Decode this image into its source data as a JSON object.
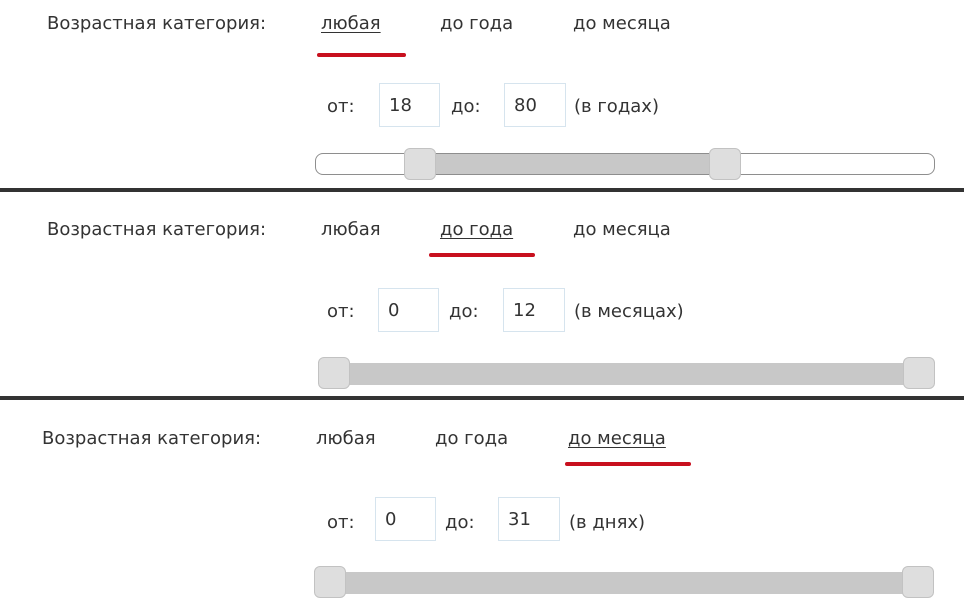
{
  "panels": [
    {
      "category_label": "Возрастная категория:",
      "tabs": [
        "любая",
        "до года",
        "до месяца"
      ],
      "active_tab": 0,
      "from_label": "от:",
      "from_value": "18",
      "to_label": "до:",
      "to_value": "80",
      "unit": "(в годах)",
      "range_low_fraction": 0.15,
      "range_high_fraction": 0.67
    },
    {
      "category_label": "Возрастная категория:",
      "tabs": [
        "любая",
        "до года",
        "до месяца"
      ],
      "active_tab": 1,
      "from_label": "от:",
      "from_value": "0",
      "to_label": "до:",
      "to_value": "12",
      "unit": "(в месяцах)",
      "range_low_fraction": 0.0,
      "range_high_fraction": 1.0
    },
    {
      "category_label": "Возрастная категория:",
      "tabs": [
        "любая",
        "до года",
        "до месяца"
      ],
      "active_tab": 2,
      "from_label": "от:",
      "from_value": "0",
      "to_label": "до:",
      "to_value": "31",
      "unit": "(в днях)",
      "range_low_fraction": 0.0,
      "range_high_fraction": 1.0
    }
  ],
  "colors": {
    "active_underline": "#c8101e",
    "divider": "#333333",
    "slider_range": "#c8c8c8",
    "slider_handle": "#dedede",
    "input_border": "#d6e4ee"
  }
}
